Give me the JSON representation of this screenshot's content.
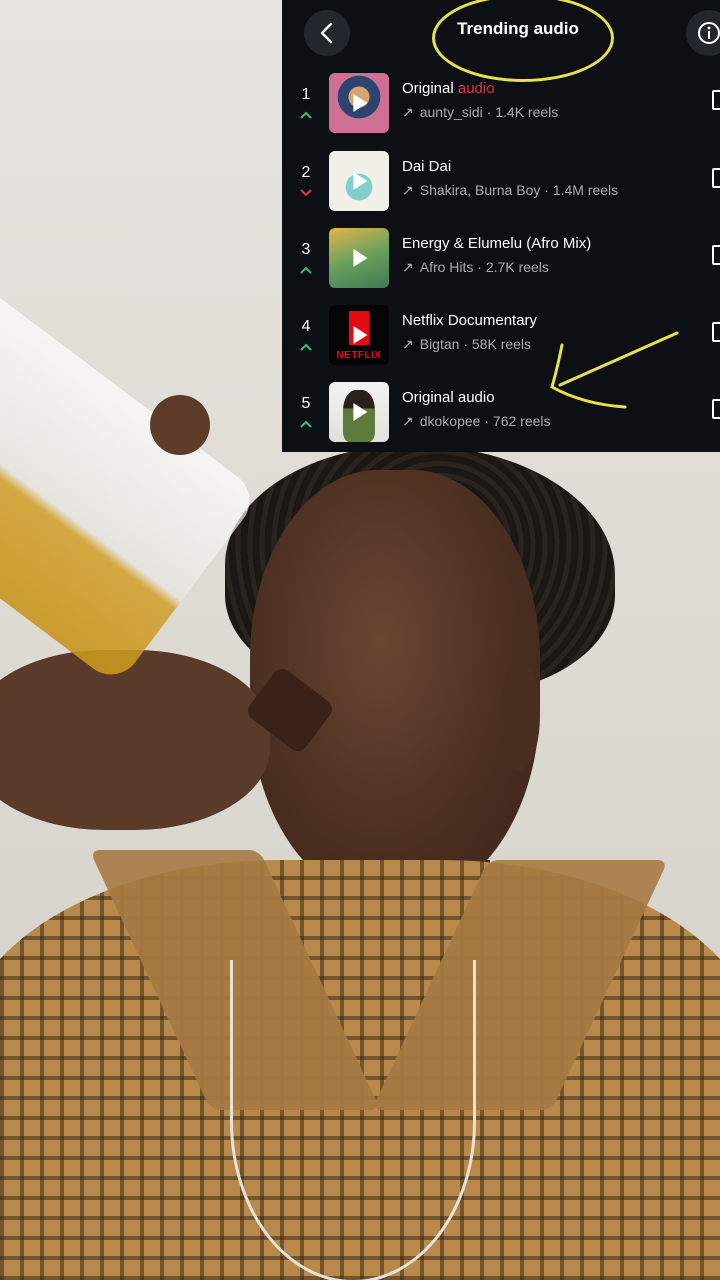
{
  "header": {
    "title": "Trending audio",
    "back_icon": "chevron-left-icon",
    "info_icon": "info-icon"
  },
  "items": [
    {
      "rank": "1",
      "trend": "up",
      "title_prefix": "Original ",
      "title_highlight": "audio",
      "artist": "aunty_sidi",
      "count": "1.4K reels"
    },
    {
      "rank": "2",
      "trend": "down",
      "title_prefix": "Dai Dai",
      "title_highlight": "",
      "artist": "Shakira, Burna Boy",
      "count": "1.4M reels"
    },
    {
      "rank": "3",
      "trend": "up",
      "title_prefix": "Energy & Elumelu (Afro Mix)",
      "title_highlight": "",
      "artist": "Afro Hits",
      "count": "2.7K reels"
    },
    {
      "rank": "4",
      "trend": "up",
      "title_prefix": "Netflix Documentary",
      "title_highlight": "",
      "artist": "Bigtan",
      "count": "58K reels"
    },
    {
      "rank": "5",
      "trend": "up",
      "title_prefix": "Original audio",
      "title_highlight": "",
      "artist": "dkokopee",
      "count": "762 reels"
    }
  ],
  "thumb_texts": {
    "netflix": "NETFLIX"
  },
  "colors": {
    "panel_bg": "#0c1015",
    "trend_up": "#2ec27e",
    "trend_down": "#e0355a",
    "highlight": "#e0353a",
    "annotation": "#e8e24a"
  },
  "separator": " · "
}
